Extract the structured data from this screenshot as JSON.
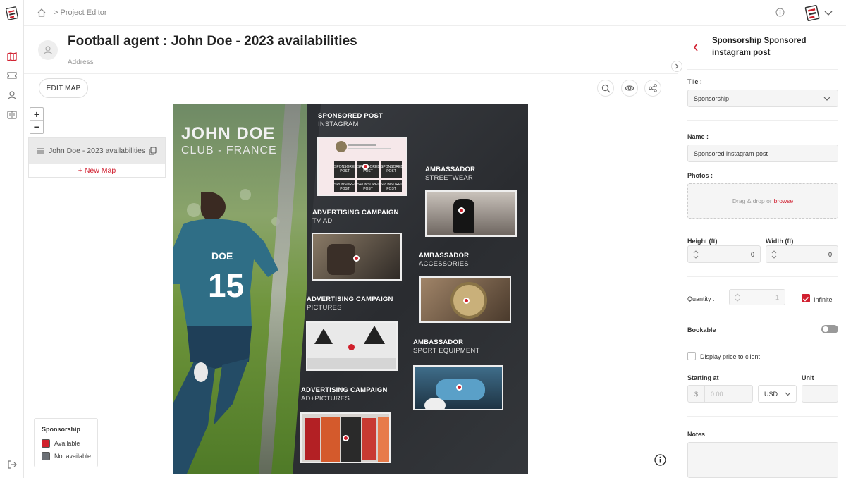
{
  "breadcrumb": {
    "separator": ">",
    "current": "Project Editor"
  },
  "project": {
    "title": "Football agent : John Doe - 2023 availabilities",
    "subtitle": "Address"
  },
  "toolbar": {
    "edit_map_label": "EDIT MAP"
  },
  "maps": {
    "items": [
      {
        "label": "John Doe - 2023 availabilities"
      }
    ],
    "new_map_label": "+ New Map"
  },
  "zoom": {
    "in": "+",
    "out": "−"
  },
  "legend": {
    "title": "Sponsorship",
    "items": [
      {
        "label": "Available",
        "color": "#d0202c"
      },
      {
        "label": "Not available",
        "color": "#6b6f75"
      }
    ]
  },
  "poster": {
    "name": "JOHN DOE",
    "club": "CLUB - FRANCE",
    "jersey_name": "DOE",
    "jersey_number": "15",
    "tiles": [
      {
        "title": "SPONSORED POST",
        "sub": "INSTAGRAM"
      },
      {
        "title": "AMBASSADOR",
        "sub": "STREETWEAR"
      },
      {
        "title": "ADVERTISING CAMPAIGN",
        "sub": "TV AD"
      },
      {
        "title": "AMBASSADOR",
        "sub": "ACCESSORIES"
      },
      {
        "title": "ADVERTISING CAMPAIGN",
        "sub": "PICTURES"
      },
      {
        "title": "AMBASSADOR",
        "sub": "SPORT EQUIPMENT"
      },
      {
        "title": "ADVERTISING CAMPAIGN",
        "sub": "AD+PICTURES"
      }
    ],
    "insta_cell": "SPONSORED POST"
  },
  "panel": {
    "title": "Sponsorship Sponsored instagram post",
    "tile_label": "Tile :",
    "tile_value": "Sponsorship",
    "name_label": "Name :",
    "name_value": "Sponsored instagram post",
    "photos_label": "Photos :",
    "dropzone_text": "Drag & drop or",
    "dropzone_link": "browse",
    "height_label": "Height (ft)",
    "height_value": "0",
    "width_label": "Width (ft)",
    "width_value": "0",
    "quantity_label": "Quantity :",
    "quantity_value": "1",
    "infinite_label": "Infinite",
    "infinite_checked": true,
    "bookable_label": "Bookable",
    "bookable_on": false,
    "display_price_label": "Display price to client",
    "display_price_checked": false,
    "starting_at_label": "Starting at",
    "currency_symbol": "$",
    "price_placeholder": "0.00",
    "currency_value": "USD",
    "unit_label": "Unit",
    "notes_label": "Notes"
  },
  "colors": {
    "accent": "#d12030"
  }
}
